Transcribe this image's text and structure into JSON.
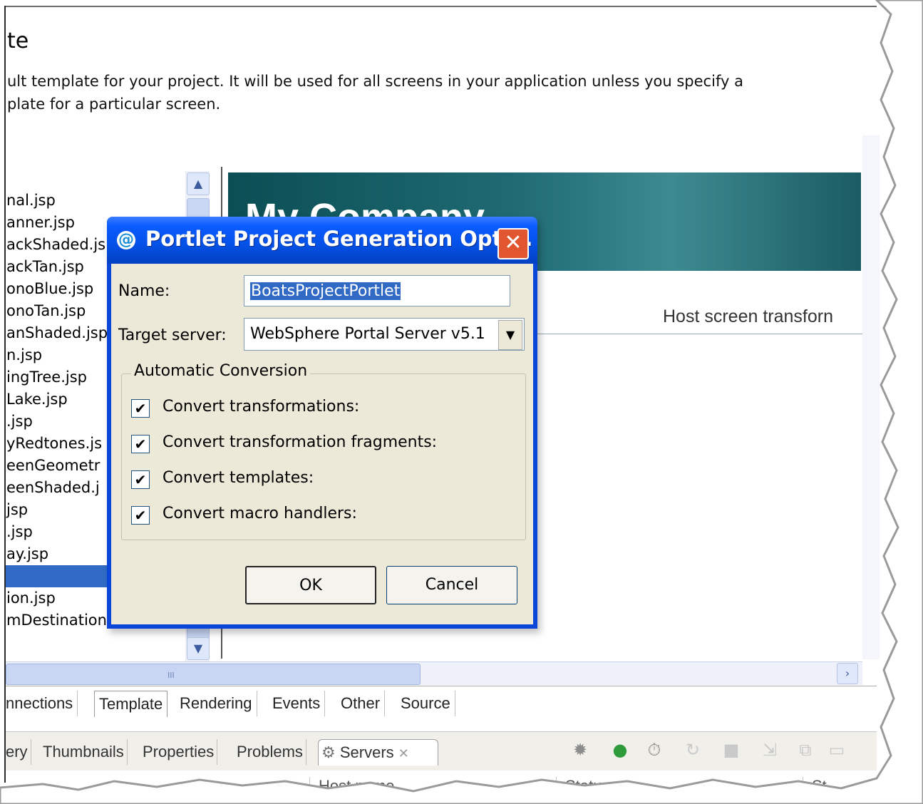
{
  "editor": {
    "title_fragment": "te",
    "description_lines": [
      "ult template for your project. It will be used for all screens in your application unless you specify a",
      "plate for a particular screen."
    ],
    "files": [
      "nal.jsp",
      "anner.jsp",
      "ackShaded.js",
      "ackTan.jsp",
      "onoBlue.jsp",
      "onoTan.jsp",
      "anShaded.jsp",
      "n.jsp",
      "ingTree.jsp",
      "Lake.jsp",
      ".jsp",
      "yRedtones.js",
      "eenGeometr",
      "eenShaded.j",
      "jsp",
      ".jsp",
      "ay.jsp",
      "",
      "ion.jsp",
      "mDestination.jsp"
    ],
    "preview": {
      "company_name": "My Company",
      "host_screen_text": "Host screen transforn"
    },
    "tabs": [
      "nnections",
      "Template",
      "Rendering",
      "Events",
      "Other",
      "Source"
    ],
    "active_tab": "Template"
  },
  "views": {
    "tabs": [
      "ery",
      "Thumbnails",
      "Properties",
      "Problems",
      "Servers"
    ],
    "active_tab": "Servers",
    "columns": [
      "Host name",
      "Status",
      "St"
    ]
  },
  "dialog": {
    "title": "Portlet Project Generation Opti...",
    "name_label": "Name:",
    "name_value": "BoatsProjectPortlet",
    "server_label": "Target server:",
    "server_value": "WebSphere Portal Server v5.1",
    "group_label": "Automatic Conversion",
    "checkboxes": [
      {
        "label": "Convert transformations:",
        "checked": true
      },
      {
        "label": "Convert transformation fragments:",
        "checked": true
      },
      {
        "label": "Convert templates:",
        "checked": true
      },
      {
        "label": "Convert macro handlers:",
        "checked": true
      }
    ],
    "ok_label": "OK",
    "cancel_label": "Cancel"
  },
  "icons": {
    "title": "portlet-swirl-icon",
    "close": "close-icon",
    "servers_tab": "servers-icon"
  }
}
